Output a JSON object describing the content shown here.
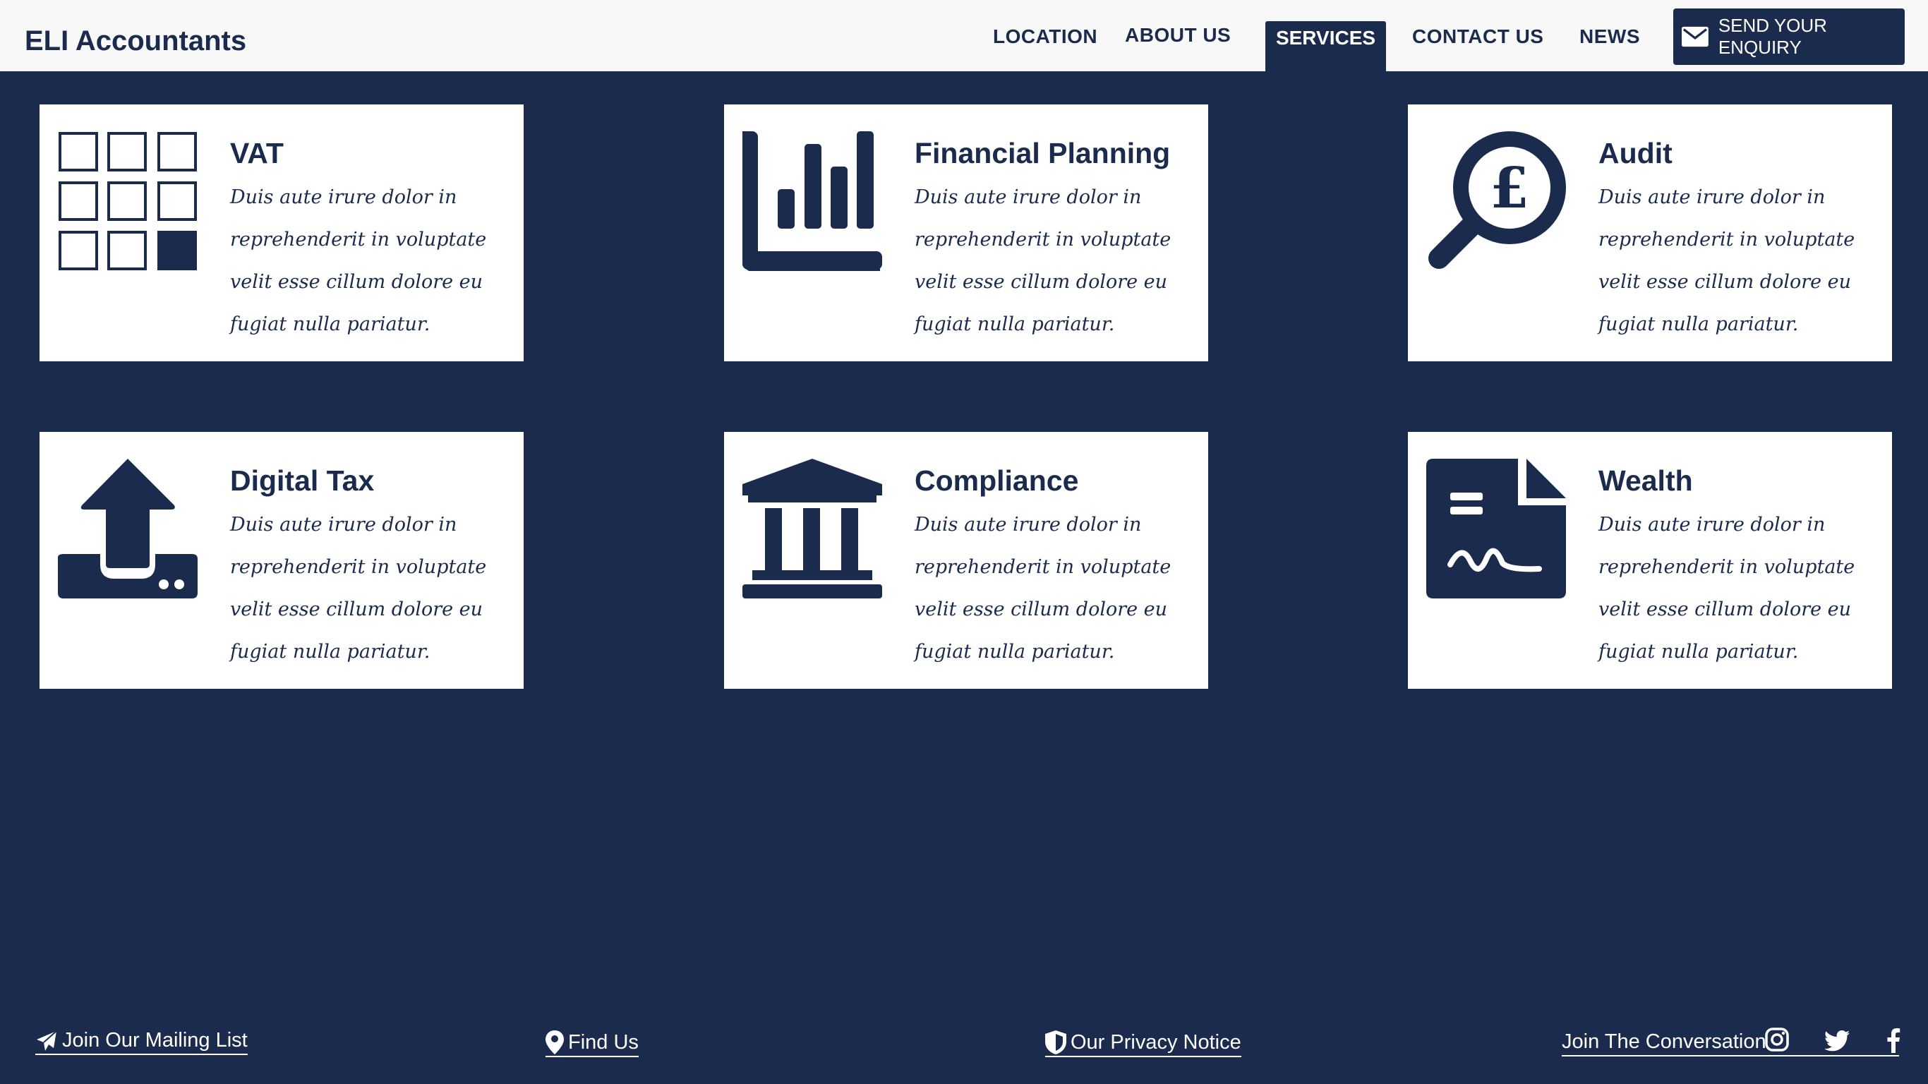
{
  "brand": "ELI Accountants",
  "nav": {
    "location": "LOCATION",
    "about": "ABOUT US",
    "services": "SERVICES",
    "contact": "CONTACT US",
    "news": "NEWS"
  },
  "enquiry": {
    "label": "SEND YOUR ENQUIRY",
    "icon": "envelope-icon"
  },
  "cards": [
    {
      "title": "VAT",
      "icon": "grid-icon",
      "desc": "Duis aute irure dolor in reprehenderit in voluptate velit esse cillum dolore eu fugiat nulla pariatur."
    },
    {
      "title": "Financial Planning",
      "icon": "bar-chart-icon",
      "desc": "Duis aute irure dolor in reprehenderit in voluptate velit esse cillum dolore eu fugiat nulla pariatur."
    },
    {
      "title": "Audit",
      "icon": "search-pound-icon",
      "desc": "Duis aute irure dolor in reprehenderit in voluptate velit esse cillum dolore eu fugiat nulla pariatur."
    },
    {
      "title": "Digital Tax",
      "icon": "upload-tray-icon",
      "desc": "Duis aute irure dolor in reprehenderit in voluptate velit esse cillum dolore eu fugiat nulla pariatur."
    },
    {
      "title": "Compliance",
      "icon": "bank-icon",
      "desc": "Duis aute irure dolor in reprehenderit in voluptate velit esse cillum dolore eu fugiat nulla pariatur."
    },
    {
      "title": "Wealth",
      "icon": "signed-document-icon",
      "desc": "Duis aute irure dolor in reprehenderit in voluptate velit esse cillum dolore eu fugiat nulla pariatur."
    }
  ],
  "footer": {
    "mailing": "Join Our Mailing List",
    "find": "Find Us",
    "privacy": "Our Privacy Notice",
    "conversation": "Join The Conversation"
  },
  "colors": {
    "navy": "#1b2b4d",
    "white": "#ffffff",
    "header_bg": "#f8f8f8"
  }
}
